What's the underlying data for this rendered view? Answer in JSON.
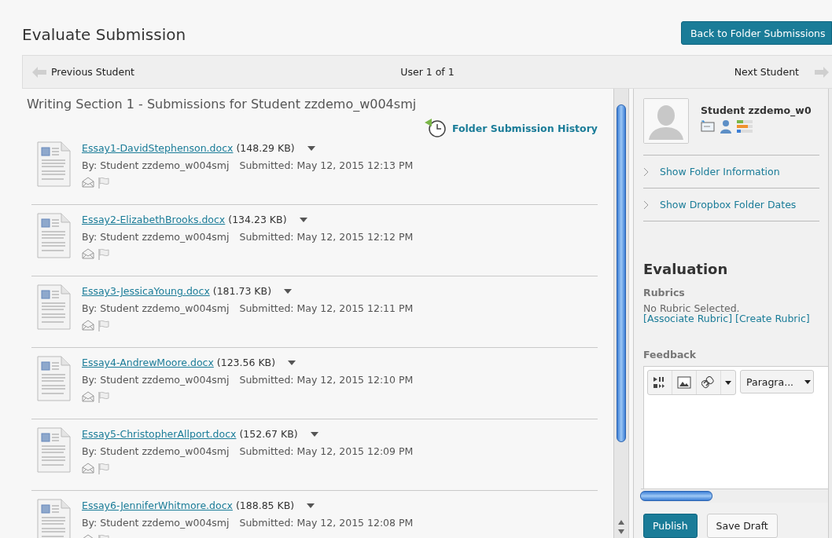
{
  "page_title": "Evaluate Submission",
  "back_button": "Back to Folder Submissions",
  "nav": {
    "previous": "Previous Student",
    "position": "User 1 of 1",
    "next": "Next Student"
  },
  "section_title": "Writing Section 1 - Submissions for Student zzdemo_w004smj",
  "history_link": "Folder Submission History",
  "submissions": [
    {
      "file": "Essay1-DavidStephenson.docx",
      "size": "(148.29 KB)",
      "by": "By: Student zzdemo_w004smj",
      "submitted": "Submitted: May 12, 2015 12:13 PM"
    },
    {
      "file": "Essay2-ElizabethBrooks.docx",
      "size": "(134.23 KB)",
      "by": "By: Student zzdemo_w004smj",
      "submitted": "Submitted: May 12, 2015 12:12 PM"
    },
    {
      "file": "Essay3-JessicaYoung.docx",
      "size": "(181.73 KB)",
      "by": "By: Student zzdemo_w004smj",
      "submitted": "Submitted: May 12, 2015 12:11 PM"
    },
    {
      "file": "Essay4-AndrewMoore.docx",
      "size": "(123.56 KB)",
      "by": "By: Student zzdemo_w004smj",
      "submitted": "Submitted: May 12, 2015 12:10 PM"
    },
    {
      "file": "Essay5-ChristopherAllport.docx",
      "size": "(152.67 KB)",
      "by": "By: Student zzdemo_w004smj",
      "submitted": "Submitted: May 12, 2015 12:09 PM"
    },
    {
      "file": "Essay6-JenniferWhitmore.docx",
      "size": "(188.85 KB)",
      "by": "By: Student zzdemo_w004smj",
      "submitted": "Submitted: May 12, 2015 12:08 PM"
    }
  ],
  "student": {
    "name": "Student zzdemo_w0"
  },
  "sections": [
    {
      "label": "Show Folder Information",
      "expanded": false
    },
    {
      "label": "Show Dropbox Folder Dates",
      "expanded": false
    }
  ],
  "evaluation": {
    "title": "Evaluation",
    "rubrics_label": "Rubrics",
    "rubric_status": "No Rubric Selected.",
    "rubric_links": [
      "[Associate Rubric]",
      "[Create Rubric]"
    ]
  },
  "feedback": {
    "label": "Feedback",
    "format": "Paragra..."
  },
  "buttons": [
    {
      "label": "Publish",
      "kind": "primary"
    },
    {
      "label": "Save Draft",
      "kind": "secondary"
    }
  ]
}
